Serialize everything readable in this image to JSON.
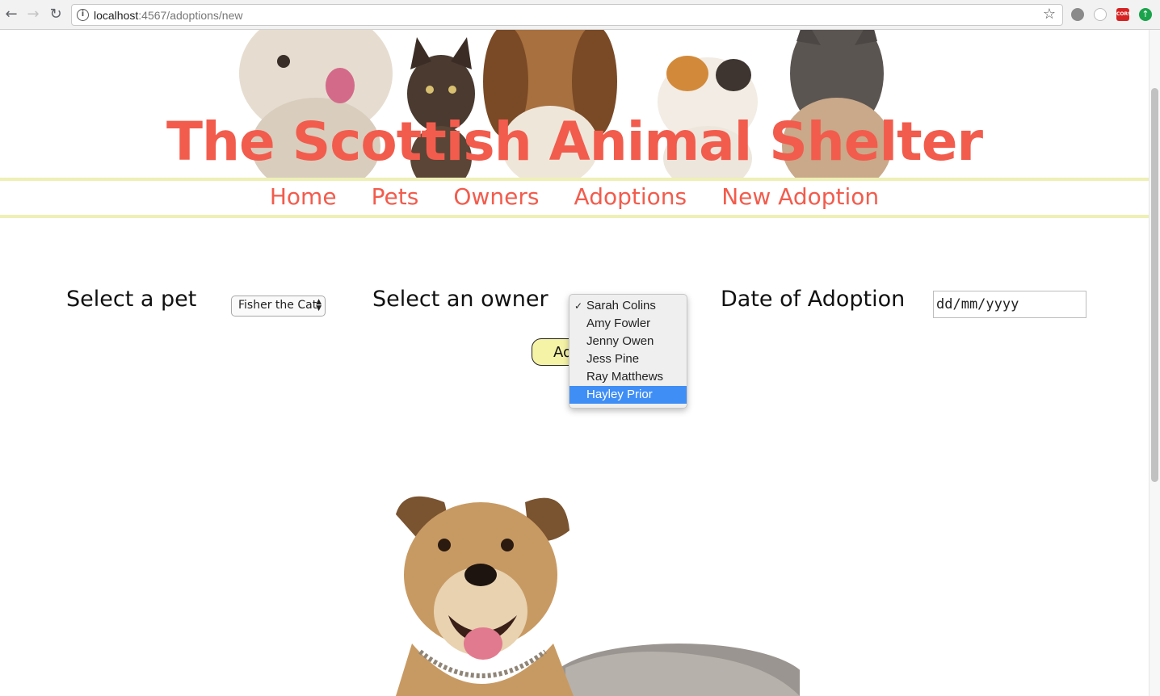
{
  "browser": {
    "url_host": "localhost",
    "url_path": ":4567/adoptions/new",
    "back_icon": "back-arrow-icon",
    "forward_icon": "forward-arrow-icon",
    "reload_icon": "reload-icon",
    "extension_cors_label": "CORS"
  },
  "site": {
    "title": "The Scottish Animal Shelter",
    "nav": [
      "Home",
      "Pets",
      "Owners",
      "Adoptions",
      "New Adoption"
    ]
  },
  "form": {
    "pet_label": "Select a pet",
    "pet_selected": "Fisher the Cat",
    "owner_label": "Select an owner",
    "date_label": "Date of Adoption",
    "date_placeholder": "dd/mm/yyyy",
    "add_button_visible_text": "Ad"
  },
  "owner_dropdown": {
    "checked": "Sarah Colins",
    "highlighted": "Hayley Prior",
    "options": [
      "Sarah Colins",
      "Amy Fowler",
      "Jenny Owen",
      "Jess Pine",
      "Ray Matthews",
      "Hayley Prior"
    ]
  },
  "colors": {
    "brand": "#f25c4d",
    "nav_border": "#eef0b5",
    "button_bg": "#f5f3a6",
    "highlight": "#3f8ef6"
  }
}
